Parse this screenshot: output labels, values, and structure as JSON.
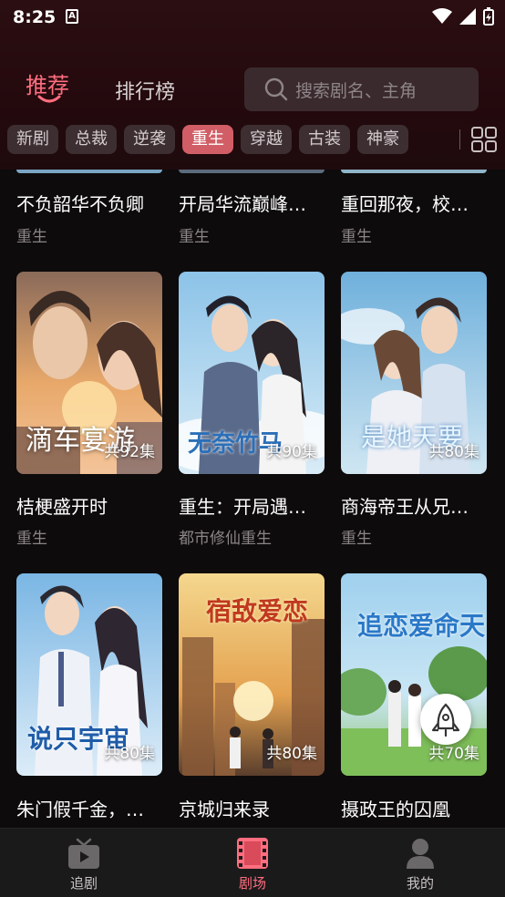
{
  "status_bar": {
    "time": "8:25",
    "notification_letter": "A"
  },
  "header": {
    "tabs": [
      {
        "label": "推荐",
        "active": true
      },
      {
        "label": "排行榜",
        "active": false
      }
    ],
    "search": {
      "placeholder": "搜索剧名、主角",
      "icon": "search-icon"
    }
  },
  "categories": [
    {
      "label": "新剧",
      "active": false
    },
    {
      "label": "总裁",
      "active": false
    },
    {
      "label": "逆袭",
      "active": false
    },
    {
      "label": "重生",
      "active": true
    },
    {
      "label": "穿越",
      "active": false
    },
    {
      "label": "古装",
      "active": false
    },
    {
      "label": "神豪",
      "active": false
    }
  ],
  "dramas": [
    {
      "title": "不负韶华不负卿",
      "tag": "重生"
    },
    {
      "title": "开局华流巅峰…",
      "tag": "重生"
    },
    {
      "title": "重回那夜，校…",
      "tag": "重生"
    },
    {
      "title": "桔梗盛开时",
      "tag": "重生",
      "episodes": "共92集",
      "poster_text": "滴车宴游"
    },
    {
      "title": "重生：开局遇…",
      "tag": "都市修仙重生",
      "episodes": "共90集",
      "poster_text": "无奈竹马"
    },
    {
      "title": "商海帝王从兄…",
      "tag": "重生",
      "episodes": "共80集",
      "poster_text": "是她天要"
    },
    {
      "title": "朱门假千金，…",
      "tag": "",
      "episodes": "共80集",
      "poster_text": "说只宇宙"
    },
    {
      "title": "京城归来录",
      "tag": "",
      "episodes": "共80集",
      "poster_text": "宿敌爱恋"
    },
    {
      "title": "摄政王的囚凰",
      "tag": "",
      "episodes": "共70集",
      "poster_text": "追恋爱命天"
    }
  ],
  "bottom_nav": [
    {
      "label": "追剧",
      "icon": "tv-icon",
      "active": false
    },
    {
      "label": "剧场",
      "icon": "film-icon",
      "active": true
    },
    {
      "label": "我的",
      "icon": "user-icon",
      "active": false
    }
  ],
  "colors": {
    "accent": "#ff6e7f",
    "active_chip": "#d15e66",
    "background": "#0d0b0c"
  }
}
